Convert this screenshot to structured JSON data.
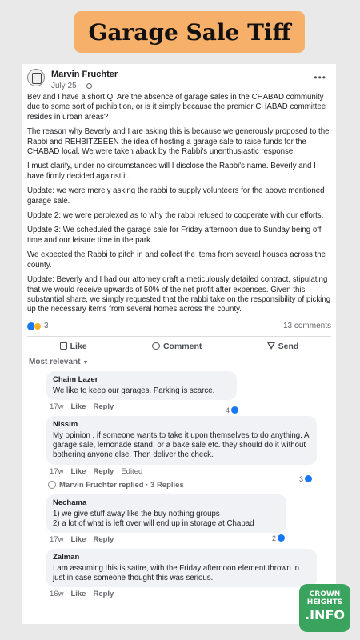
{
  "banner": {
    "title": "Garage Sale  Tiff"
  },
  "post": {
    "author": "Marvin Fruchter",
    "date": "July 25 ·",
    "paragraphs": [
      "Bev and I have a short Q.  Are the absence of garage sales in the CHABAD community due to some sort of prohibition, or is it simply because the premier CHABAD committee resides in urban areas?",
      "The reason why Beverly and I are asking this is because we generously proposed to the Rabbi and REHBITZEEEN the idea of hosting a garage sale to raise funds for the CHABAD local. We were taken aback by the Rabbi's unenthusiastic response.",
      "I must clarify, under no circumstances will I disclose the Rabbi's name. Beverly and I have firmly decided against it.",
      "Update: we were merely asking the rabbi to supply volunteers for the above mentioned garage sale.",
      "Update 2: we were perplexed as to why the rabbi refused to cooperate with our efforts.",
      "Update 3: We scheduled the garage sale for Friday afternoon due to Sunday being off time and our leisure time in the park.",
      "We expected the Rabbi to pitch in and collect the items from several houses across the county.",
      "Update: Beverly and I had our attorney draft a meticulously detailed contract, stipulating that we would receive upwards of 50% of the net profit after expenses. Given this substantial share, we simply requested that the rabbi take on the responsibility of picking up the necessary items from several homes across the county."
    ],
    "reaction_count": "3",
    "comments_count": "13 comments"
  },
  "actions": {
    "like": "Like",
    "comment": "Comment",
    "send": "Send"
  },
  "sort_label": "Most relevant",
  "comments": [
    {
      "name": "Chaim Lazer",
      "text": "We like to keep our garages. Parking is scarce.",
      "age": "17w",
      "like": "Like",
      "reply": "Reply",
      "edited": "",
      "reactions": "4"
    },
    {
      "name": "Nissim",
      "text": "My opinion , if someone wants to take it upon themselves to do anything, A garage sale, lemonade stand, or a bake sale etc. they should do it without bothering anyone else. Then deliver the check.",
      "age": "17w",
      "like": "Like",
      "reply": "Reply",
      "edited": "Edited",
      "reactions": "3"
    },
    {
      "name": "Nechama",
      "text": "1) we give stuff away like the buy nothing groups\n2) a lot of what is left over will end up in storage at Chabad",
      "age": "17w",
      "like": "Like",
      "reply": "Reply",
      "edited": "",
      "reactions": "2"
    },
    {
      "name": "Zalman",
      "text": "I am assuming this is satire, with the Friday afternoon element thrown in just in case someone thought this was serious.",
      "age": "16w",
      "like": "Like",
      "reply": "Reply",
      "edited": "",
      "reactions": ""
    }
  ],
  "replies_line": "Marvin Fruchter replied · 3 Replies",
  "logo": {
    "top": "CROWN HEIGHTS",
    "bottom": ".INFO"
  }
}
